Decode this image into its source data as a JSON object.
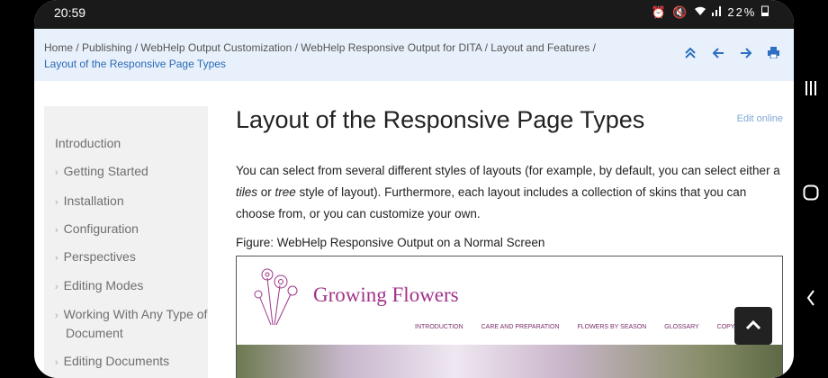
{
  "status": {
    "time": "20:59",
    "battery": "22%"
  },
  "breadcrumb": {
    "path": "Home / Publishing / WebHelp Output Customization / WebHelp Responsive Output for DITA / Layout and Features /",
    "current": "Layout of the Responsive Page Types"
  },
  "nav_icons": [
    "collapse-icon",
    "arrow-left-icon",
    "arrow-right-icon",
    "print-icon"
  ],
  "toc": {
    "items": [
      {
        "label": "Introduction"
      },
      {
        "label": "Getting Started"
      },
      {
        "label": "Installation"
      },
      {
        "label": "Configuration"
      },
      {
        "label": "Perspectives"
      },
      {
        "label": "Editing Modes"
      },
      {
        "label": "Working With Any Type of Document"
      },
      {
        "label": "Editing Documents"
      }
    ]
  },
  "content": {
    "title": "Layout of the Responsive Page Types",
    "edit_link": "Edit online",
    "para_part1": "You can select from several different styles of layouts (for example, by default, you can select either a ",
    "tiles": "tiles",
    "para_part2": " or ",
    "tree": "tree",
    "para_part3": " style of layout). Furthermore, each layout includes a collection of skins that you can choose from, or you can customize your own.",
    "figure_caption": "Figure: WebHelp Responsive Output on a Normal Screen",
    "figure": {
      "logo": "Growing Flowers",
      "nav": [
        "INTRODUCTION",
        "CARE AND PREPARATION",
        "FLOWERS BY SEASON",
        "GLOSSARY",
        "COPYR"
      ]
    }
  },
  "colors": {
    "accent": "#2a6ab5",
    "breadcrumb_bg": "#e8f0fb",
    "toc_bg": "#f1f1f1"
  }
}
